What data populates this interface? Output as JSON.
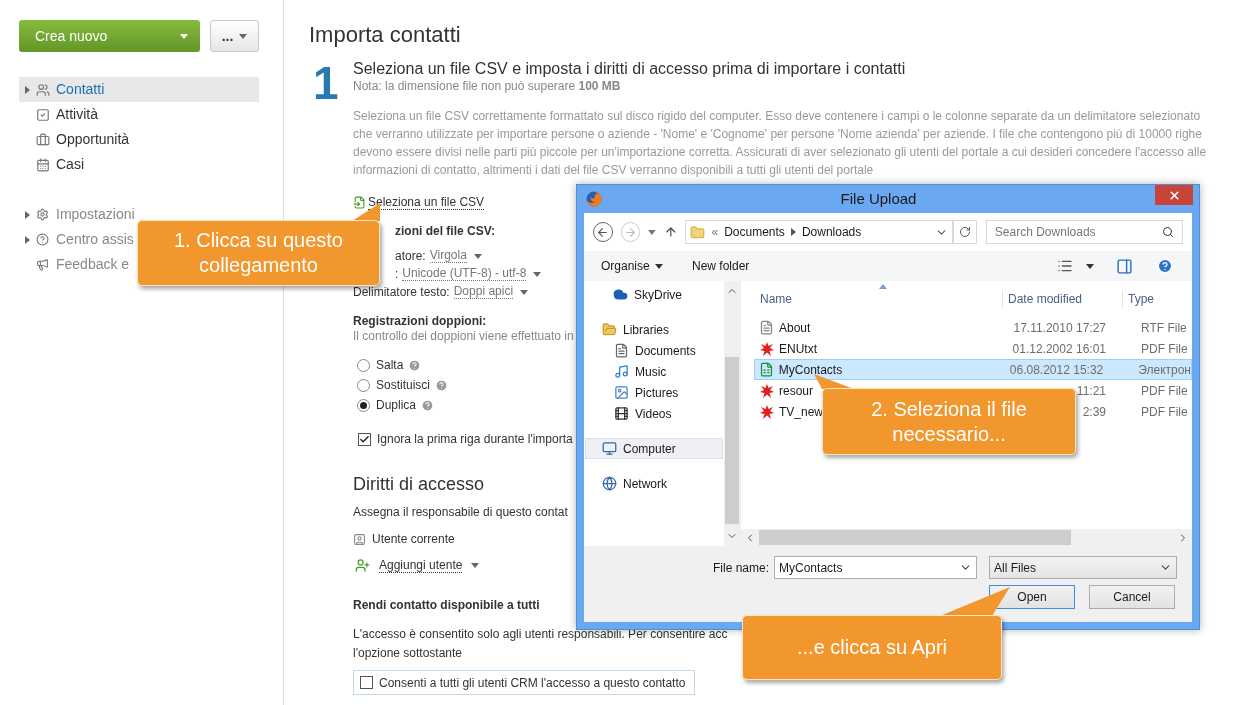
{
  "sidebar": {
    "create_button": "Crea nuovo",
    "more_button": "...",
    "nav": [
      {
        "label": "Contatti",
        "selected": true,
        "expandable": true
      },
      {
        "label": "Attività",
        "selected": false,
        "expandable": false
      },
      {
        "label": "Opportunità",
        "selected": false,
        "expandable": false
      },
      {
        "label": "Casi",
        "selected": false,
        "expandable": false
      }
    ],
    "settings": [
      {
        "label": "Impostazioni",
        "expandable": true
      },
      {
        "label": "Centro assis",
        "expandable": true
      },
      {
        "label": "Feedback e",
        "expandable": false
      }
    ]
  },
  "main": {
    "title": "Importa contatti",
    "step": "1",
    "heading": "Seleziona un file CSV e imposta i diritti di accesso prima di importare i contatti",
    "note": "Nota: la dimensione file non può superare **100 MB**",
    "description": "Seleziona un file CSV correttamente formattato sul disco rigido del computer. Esso deve contenere i campi o le colonne separate da un delimitatore selezionato che verranno utilizzate per importare persone o aziende - 'Nome' e 'Cognome' per persone 'Nome azienda' per aziende. I file che contengono più di 10000 righe devono essere divisi nelle parti più piccole per un'importazione corretta. Assicurati di aver selezionato gli utenti del portale a cui desideri concedere l'accesso alle informazioni di contatto, altrimenti i dati del file CSV verranno disponibili a tutti gli utenti del portale",
    "file_link": "Seleziona un file CSV",
    "csv_settings": {
      "heading": "zioni del file CSV:",
      "rows": [
        {
          "label": "atore:",
          "value": "Virgola"
        },
        {
          "label": ":",
          "value": "Unicode (UTF-8) - utf-8"
        },
        {
          "label": "Delimitatore testo:",
          "value": "Doppi apici"
        }
      ]
    },
    "duplicates": {
      "heading": "Registrazioni doppioni:",
      "note": "Il controllo dei doppioni viene effettuato in",
      "options": [
        {
          "label": "Salta",
          "selected": false
        },
        {
          "label": "Sostituisci",
          "selected": false
        },
        {
          "label": "Duplica",
          "selected": true
        }
      ],
      "skip_first_row": {
        "label": "Ignora la prima riga durante l'importa",
        "checked": true
      }
    },
    "access": {
      "heading": "Diritti di accesso",
      "assign_text": "Assegna il responsabile di questo contat",
      "current_user": "Utente corrente",
      "add_user": "Aggiungi utente",
      "share_heading": "Rendi contatto disponibile a tutti",
      "share_text": [
        "L'accesso è consentito solo agli utenti responsabili. Per consentire acc",
        "l'opzione sottostante"
      ],
      "share_checkbox": {
        "label": "Consenti a tutti gli utenti CRM l'accesso a questo contatto",
        "checked": false
      }
    }
  },
  "dialog": {
    "title": "File Upload",
    "breadcrumb": [
      "«",
      "Documents",
      "Downloads"
    ],
    "search": {
      "placeholder": "Search Downloads"
    },
    "toolbar": [
      "Organise",
      "New folder"
    ],
    "nav": [
      {
        "label": "SkyDrive",
        "selected": false
      },
      {
        "label": "Libraries",
        "selected": false,
        "children": [
          {
            "label": "Documents",
            "selected": false
          },
          {
            "label": "Music",
            "selected": false
          },
          {
            "label": "Pictures",
            "selected": false
          },
          {
            "label": "Videos",
            "selected": false
          }
        ]
      },
      {
        "label": "Computer",
        "selected": true
      },
      {
        "label": "Network",
        "selected": false
      }
    ],
    "columns": [
      "Name",
      "Date modified",
      "Type"
    ],
    "files": [
      {
        "name": "About",
        "date": "17.11.2010 17:27",
        "type": "RTF File",
        "kind": "text",
        "selected": false
      },
      {
        "name": "ENUtxt",
        "date": "01.12.2002 16:01",
        "type": "PDF File",
        "kind": "pdf",
        "selected": false
      },
      {
        "name": "MyContacts",
        "date": "06.08.2012 15:32",
        "type": "Электрон",
        "kind": "sheet",
        "selected": true
      },
      {
        "name": "resour",
        "date": "11:21",
        "type": "PDF File",
        "kind": "pdf",
        "selected": false
      },
      {
        "name": "TV_new",
        "date": "2:39",
        "type": "PDF File",
        "kind": "pdf",
        "selected": false
      }
    ],
    "file_name_label": "File name:",
    "file_name": "MyContacts",
    "filter": "All Files",
    "buttons": [
      {
        "label": "Open",
        "selected": true
      },
      {
        "label": "Cancel",
        "selected": false
      }
    ]
  },
  "callouts": [
    {
      "text": "1. Clicca su questo collegamento"
    },
    {
      "text": "2. Seleziona il file necessario..."
    },
    {
      "text": "...e clicca su Apri"
    }
  ]
}
